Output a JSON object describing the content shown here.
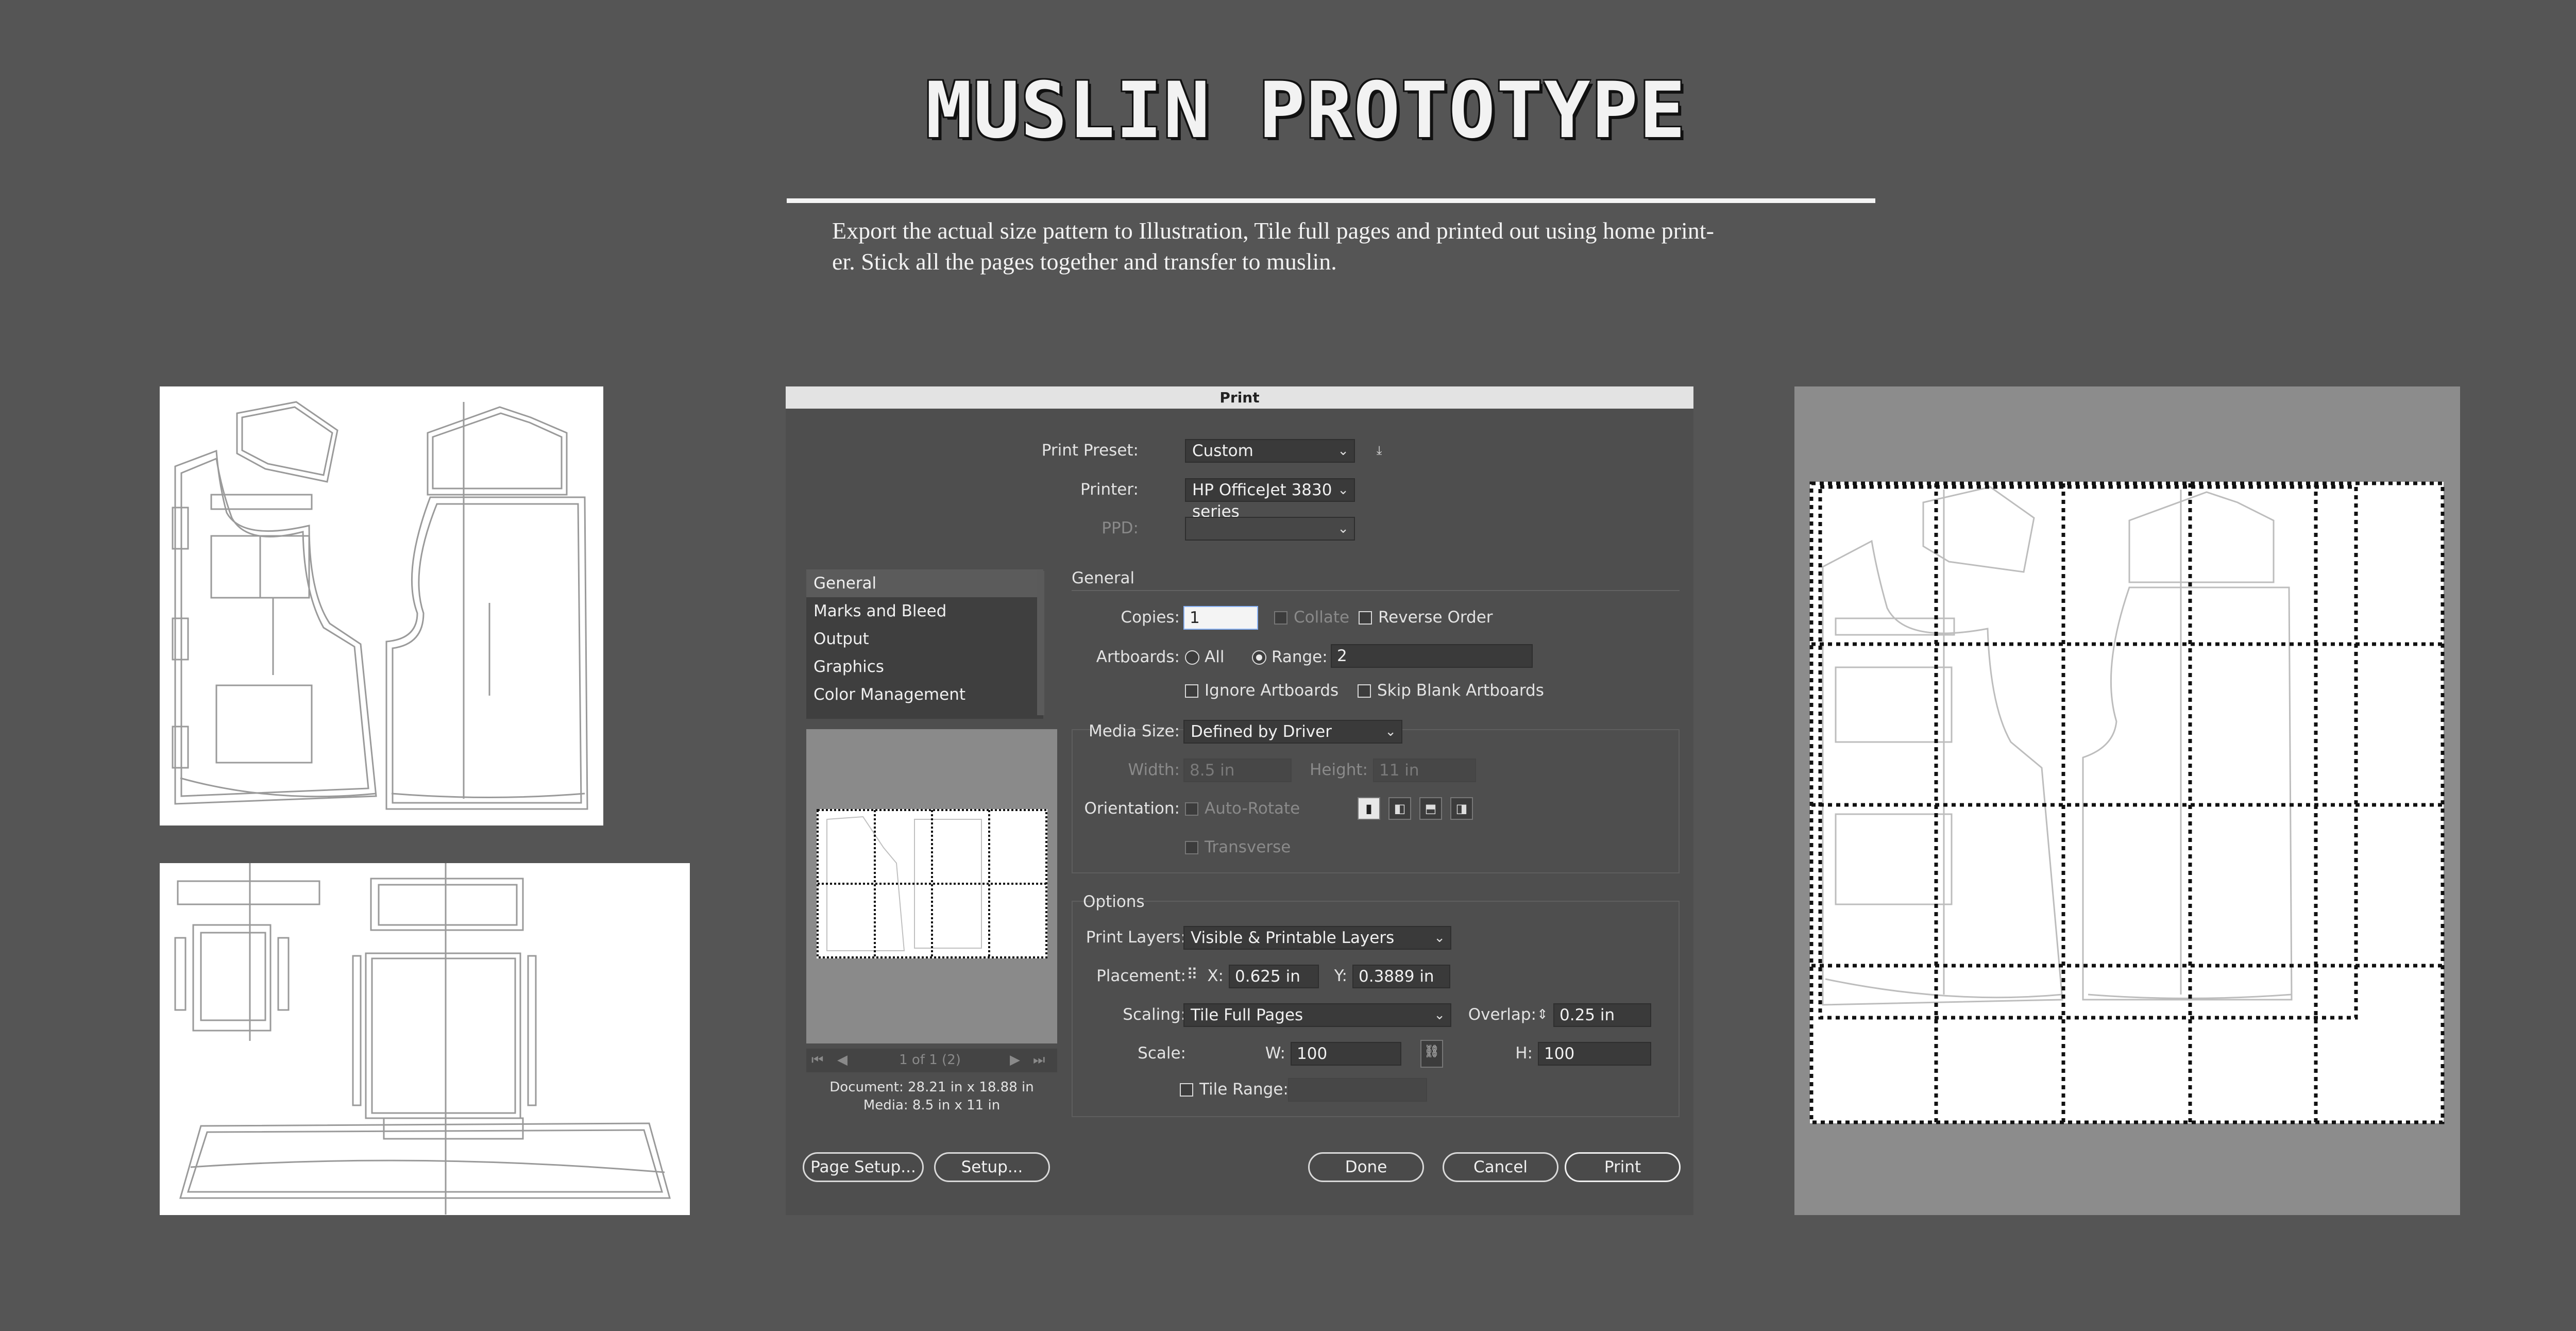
{
  "page": {
    "title": "MUSLIN PROTOTYPE",
    "description_line1": "Export the actual size pattern to Illustration, Tile full pages and printed out using home print-",
    "description_line2": "er. Stick all the pages together and transfer to muslin."
  },
  "dialog": {
    "title": "Print",
    "print_preset_label": "Print Preset:",
    "print_preset_value": "Custom",
    "printer_label": "Printer:",
    "printer_value": "HP OfficeJet 3830 series",
    "ppd_label": "PPD:",
    "categories": [
      "General",
      "Marks and Bleed",
      "Output",
      "Graphics",
      "Color Management"
    ],
    "section_general": "General",
    "copies_label": "Copies:",
    "copies_value": "1",
    "collate_label": "Collate",
    "reverse_order_label": "Reverse Order",
    "artboards_label": "Artboards:",
    "all_label": "All",
    "range_label": "Range:",
    "range_value": "2",
    "ignore_artboards_label": "Ignore Artboards",
    "skip_blank_label": "Skip Blank Artboards",
    "media_size_label": "Media Size:",
    "media_size_value": "Defined by Driver",
    "width_label": "Width:",
    "width_value": "8.5 in",
    "height_label": "Height:",
    "height_value": "11 in",
    "orientation_label": "Orientation:",
    "auto_rotate_label": "Auto-Rotate",
    "transverse_label": "Transverse",
    "section_options": "Options",
    "print_layers_label": "Print Layers:",
    "print_layers_value": "Visible & Printable Layers",
    "placement_label": "Placement:",
    "x_label": "X:",
    "x_value": "0.625 in",
    "y_label": "Y:",
    "y_value": "0.3889 in",
    "scaling_label": "Scaling:",
    "scaling_value": "Tile Full Pages",
    "overlap_label": "Overlap:",
    "overlap_value": "0.25 in",
    "scale_label": "Scale:",
    "w_label": "W:",
    "w_value": "100",
    "h_label": "H:",
    "h_value": "100",
    "tile_range_label": "Tile Range:",
    "page_nav": "1 of 1 (2)",
    "document_info": "Document: 28.21 in x 18.88 in",
    "media_info": "Media: 8.5 in x 11 in",
    "buttons": {
      "page_setup": "Page Setup...",
      "setup": "Setup...",
      "done": "Done",
      "cancel": "Cancel",
      "print": "Print"
    }
  }
}
